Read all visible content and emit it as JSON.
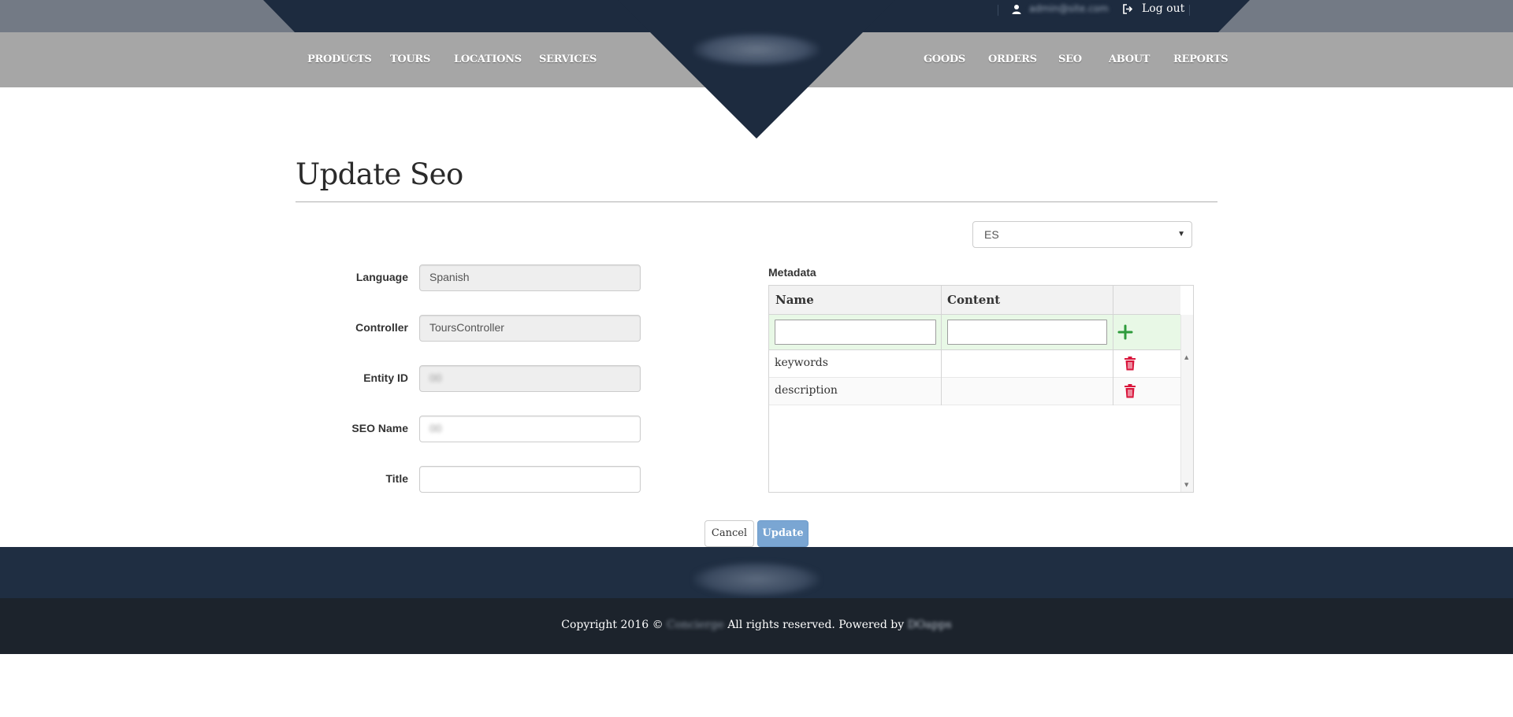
{
  "header": {
    "nav_left": [
      "PRODUCTS",
      "TOURS",
      "LOCATIONS",
      "SERVICES"
    ],
    "nav_right": [
      "GOODS",
      "ORDERS",
      "SEO",
      "ABOUT",
      "REPORTS"
    ],
    "user_email": "admin@site.com",
    "logout_label": "Log out"
  },
  "page": {
    "title": "Update Seo",
    "language_select": {
      "value": "ES"
    }
  },
  "form": {
    "language": {
      "label": "Language",
      "value": "Spanish"
    },
    "controller": {
      "label": "Controller",
      "value": "ToursController"
    },
    "entity_id": {
      "label": "Entity ID",
      "value": "00"
    },
    "seo_name": {
      "label": "SEO Name",
      "value": "00"
    },
    "title": {
      "label": "Title",
      "value": ""
    }
  },
  "metadata": {
    "label": "Metadata",
    "columns": [
      "Name",
      "Content"
    ],
    "rows": [
      {
        "name": "keywords",
        "content": ""
      },
      {
        "name": "description",
        "content": ""
      }
    ]
  },
  "actions": {
    "cancel_label": "Cancel",
    "update_label": "Update"
  },
  "footer": {
    "copyright_prefix": "Copyright 2016 ©",
    "company_name": "Concierge",
    "rights_text": "All rights reserved. Powered by",
    "powered_name": "DOapps"
  },
  "colors": {
    "header_dark": "#1d2b3f",
    "nav_bg": "#a6a6a6",
    "accent_add": "#2e9b3c",
    "accent_delete": "#d9153b",
    "update_button": "#7aa6d3"
  }
}
